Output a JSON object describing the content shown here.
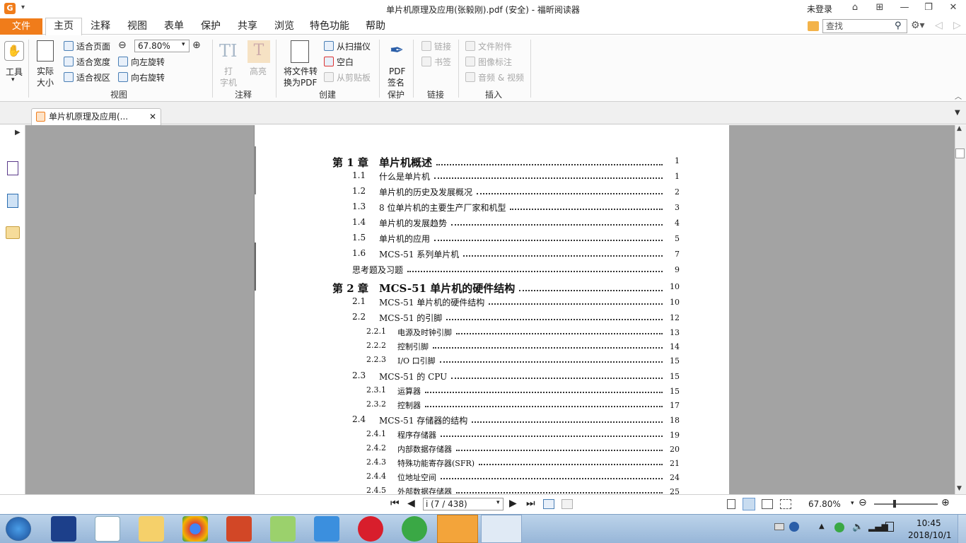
{
  "titlebar": {
    "window_title": "单片机原理及应用(张毅刚).pdf (安全) - 福昕阅读器",
    "login": "未登录",
    "logo": "G"
  },
  "menu": {
    "file": "文件",
    "tabs": [
      "主页",
      "注释",
      "视图",
      "表单",
      "保护",
      "共享",
      "浏览",
      "特色功能",
      "帮助"
    ],
    "search_placeholder": "查找"
  },
  "ribbon": {
    "tools": "工具",
    "actual_size_1": "实际",
    "actual_size_2": "大小",
    "fit_page": "适合页面",
    "fit_width": "适合宽度",
    "fit_visible": "适合视区",
    "zoom": "67.80%",
    "rotate_left": "向左旋转",
    "rotate_right": "向右旋转",
    "group_view": "视图",
    "typewriter_1": "打",
    "typewriter_2": "字机",
    "highlight": "高亮",
    "group_annot": "注释",
    "convert_1": "将文件转",
    "convert_2": "换为PDF",
    "from_scanner": "从扫描仪",
    "blank": "空白",
    "from_clipboard": "从剪贴板",
    "group_create": "创建",
    "pdf_sign_1": "PDF",
    "pdf_sign_2": "签名",
    "group_protect": "保护",
    "link": "链接",
    "bookmark": "书签",
    "group_link": "链接",
    "file_attach": "文件附件",
    "image_annot": "图像标注",
    "audio_video": "音频 & 视频",
    "group_insert": "插入"
  },
  "doc_tab": {
    "label": "单片机原理及应用(..."
  },
  "toc": [
    {
      "num": "第 1 章",
      "text": "单片机概述",
      "page": "1",
      "level": 0
    },
    {
      "num": "1.1",
      "text": "什么是单片机",
      "page": "1",
      "level": 1
    },
    {
      "num": "1.2",
      "text": "单片机的历史及发展概况",
      "page": "2",
      "level": 1
    },
    {
      "num": "1.3",
      "text": "8 位单片机的主要生产厂家和机型",
      "page": "3",
      "level": 1
    },
    {
      "num": "1.4",
      "text": "单片机的发展趋势",
      "page": "4",
      "level": 1
    },
    {
      "num": "1.5",
      "text": "单片机的应用",
      "page": "5",
      "level": 1
    },
    {
      "num": "1.6",
      "text": "MCS-51 系列单片机",
      "page": "7",
      "level": 1
    },
    {
      "num": "",
      "text": "思考题及习题",
      "page": "9",
      "level": 1
    },
    {
      "num": "第 2 章",
      "text": "MCS-51 单片机的硬件结构",
      "page": "10",
      "level": 0
    },
    {
      "num": "2.1",
      "text": "MCS-51 单片机的硬件结构",
      "page": "10",
      "level": 1
    },
    {
      "num": "2.2",
      "text": "MCS-51 的引脚",
      "page": "12",
      "level": 1
    },
    {
      "num": "2.2.1",
      "text": "电源及时钟引脚",
      "page": "13",
      "level": 2
    },
    {
      "num": "2.2.2",
      "text": "控制引脚",
      "page": "14",
      "level": 2
    },
    {
      "num": "2.2.3",
      "text": "I/O 口引脚",
      "page": "15",
      "level": 2
    },
    {
      "num": "2.3",
      "text": "MCS-51 的 CPU",
      "page": "15",
      "level": 1
    },
    {
      "num": "2.3.1",
      "text": "运算器",
      "page": "15",
      "level": 2
    },
    {
      "num": "2.3.2",
      "text": "控制器",
      "page": "17",
      "level": 2
    },
    {
      "num": "2.4",
      "text": "MCS-51 存储器的结构",
      "page": "18",
      "level": 1
    },
    {
      "num": "2.4.1",
      "text": "程序存储器",
      "page": "19",
      "level": 2
    },
    {
      "num": "2.4.2",
      "text": "内部数据存储器",
      "page": "20",
      "level": 2
    },
    {
      "num": "2.4.3",
      "text": "特殊功能寄存器(SFR)",
      "page": "21",
      "level": 2
    },
    {
      "num": "2.4.4",
      "text": "位地址空间",
      "page": "24",
      "level": 2
    },
    {
      "num": "2.4.5",
      "text": "外部数据存储器",
      "page": "25",
      "level": 2
    }
  ],
  "status": {
    "page_indicator": "i (7 / 438)",
    "zoom": "67.80%"
  },
  "taskbar": {
    "time": "10:45",
    "date": "2018/10/1",
    "apps": [
      "dev-cpp",
      "baidu-netdisk",
      "file-explorer",
      "chrome",
      "powerpoint",
      "wechat",
      "internet-explorer",
      "opera",
      "update-app",
      "foxit-reader",
      "word"
    ]
  }
}
